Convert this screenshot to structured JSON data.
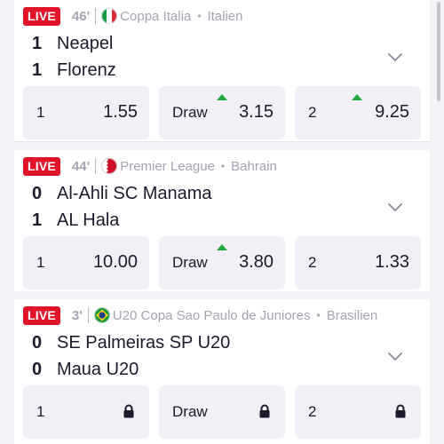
{
  "matches": [
    {
      "live_label": "LIVE",
      "minute": "46'",
      "flag": "italy-flag",
      "competition": "Coppa Italia",
      "separator_dot": "•",
      "country": "Italien",
      "home": {
        "score": "1",
        "name": "Neapel"
      },
      "away": {
        "score": "1",
        "name": "Florenz"
      },
      "odds": [
        {
          "label": "1",
          "value": "1.55",
          "trend": "none"
        },
        {
          "label": "Draw",
          "value": "3.15",
          "trend": "up"
        },
        {
          "label": "2",
          "value": "9.25",
          "trend": "up"
        }
      ]
    },
    {
      "live_label": "LIVE",
      "minute": "44'",
      "flag": "bahrain-flag",
      "competition": "Premier League",
      "separator_dot": "•",
      "country": "Bahrain",
      "home": {
        "score": "0",
        "name": "Al-Ahli SC Manama"
      },
      "away": {
        "score": "1",
        "name": "AL Hala"
      },
      "odds": [
        {
          "label": "1",
          "value": "10.00",
          "trend": "none"
        },
        {
          "label": "Draw",
          "value": "3.80",
          "trend": "up"
        },
        {
          "label": "2",
          "value": "1.33",
          "trend": "none"
        }
      ]
    },
    {
      "live_label": "LIVE",
      "minute": "3'",
      "flag": "brazil-flag",
      "competition": "U20 Copa Sao Paulo de Juniores",
      "separator_dot": "•",
      "country": "Brasilien",
      "home": {
        "score": "0",
        "name": "SE Palmeiras SP U20"
      },
      "away": {
        "score": "0",
        "name": "Maua U20"
      },
      "odds": [
        {
          "label": "1",
          "value": "",
          "trend": "locked"
        },
        {
          "label": "Draw",
          "value": "",
          "trend": "locked"
        },
        {
          "label": "2",
          "value": "",
          "trend": "locked"
        }
      ]
    }
  ],
  "colors": {
    "live_badge": "#e2142a",
    "trend_up": "#1faa3c",
    "odds_bg": "#f1f0f7",
    "muted_text": "#a7a4b2"
  }
}
